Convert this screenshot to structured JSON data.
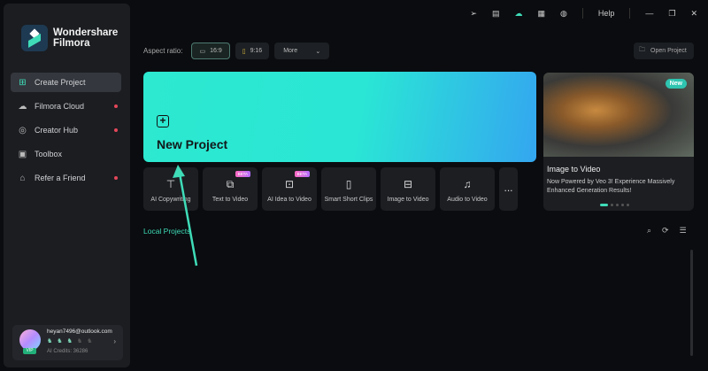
{
  "app": {
    "brand_line1": "Wondershare",
    "brand_line2": "Filmora"
  },
  "sidebar": {
    "items": [
      {
        "label": "Create Project",
        "icon": "plus-file-icon",
        "active": true,
        "dot": false
      },
      {
        "label": "Filmora Cloud",
        "icon": "cloud-icon",
        "dot": true
      },
      {
        "label": "Creator Hub",
        "icon": "compass-icon",
        "dot": true
      },
      {
        "label": "Toolbox",
        "icon": "toolbox-icon",
        "dot": false
      },
      {
        "label": "Refer a Friend",
        "icon": "gift-icon",
        "dot": true
      }
    ]
  },
  "user": {
    "email": "heyan7496@outlook.com",
    "badge": "VIP",
    "credits": "AI Credits: 36286"
  },
  "topbar": {
    "help": "Help"
  },
  "aspect": {
    "label": "Aspect ratio:",
    "options": [
      "16:9",
      "9:16"
    ],
    "more": "More"
  },
  "open_project": "Open Project",
  "new_project": "New Project",
  "tools": [
    {
      "label": "AI Copywriting",
      "beta": false
    },
    {
      "label": "Text to Video",
      "beta": true
    },
    {
      "label": "AI Idea to Video",
      "beta": true
    },
    {
      "label": "Smart Short Clips",
      "beta": false
    },
    {
      "label": "Image to Video",
      "beta": false
    },
    {
      "label": "Audio to Video",
      "beta": false
    }
  ],
  "beta_label": "BETA",
  "more_tools": "...",
  "local_projects": "Local Projects",
  "promo": {
    "badge": "New",
    "title": "Image to Video",
    "desc": "Now Powered by Veo 3! Experience Massively Enhanced Generation Results!",
    "slides": 6,
    "current_slide": 1
  },
  "colors": {
    "accent": "#3fdcb8",
    "banner_start": "#2ce9d0",
    "banner_end": "#34a6f0",
    "notification": "#e5475a"
  }
}
